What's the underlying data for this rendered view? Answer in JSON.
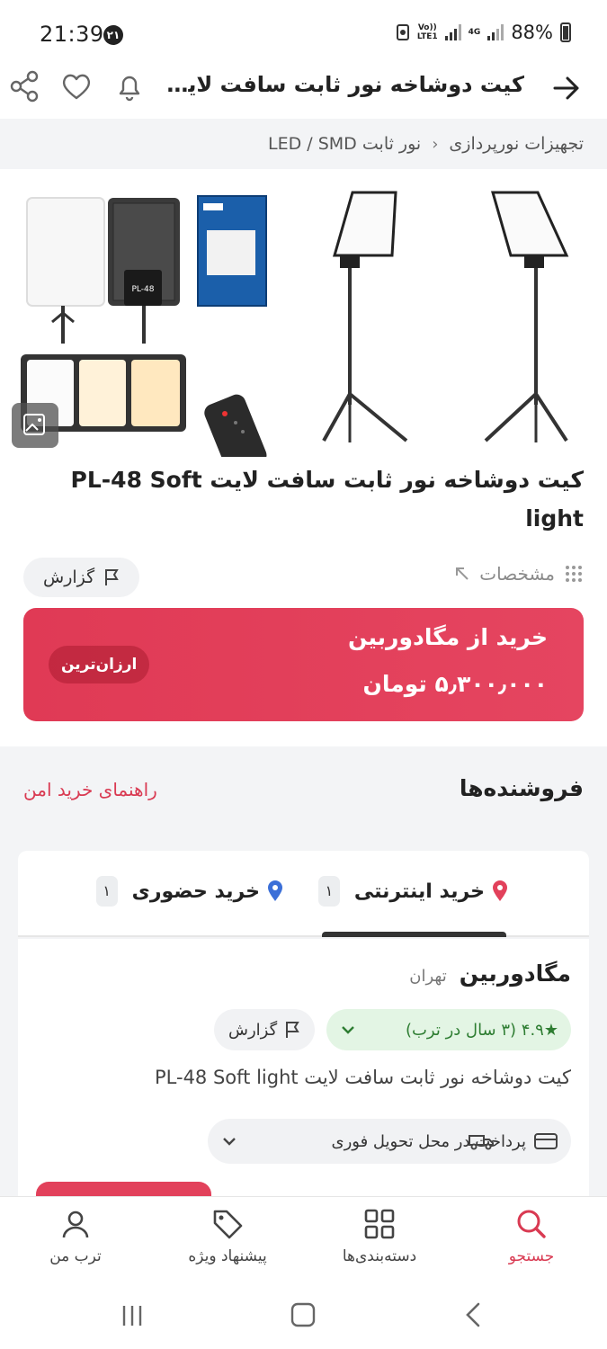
{
  "status_bar": {
    "time": "21:39",
    "notif_badge": "۲۱",
    "volte": "Vo))",
    "lte": "LTE1",
    "net": "4G",
    "battery": "88%"
  },
  "header": {
    "title": "کیت دوشاخه نور ثابت سافت لایت -..."
  },
  "breadcrumb": {
    "items": [
      "تجهیزات نورپردازی",
      "نور ثابت LED / SMD"
    ]
  },
  "product": {
    "title": "کیت دوشاخه نور ثابت سافت لایت PL-48 Soft light",
    "specs_label": "مشخصات",
    "report_label": "گزارش",
    "image_label_text": "PL-48"
  },
  "buy_card": {
    "store": "خرید از مگادوربین",
    "price": "۵٫۳۰۰٫۰۰۰ تومان",
    "tag": "ارزان‌ترین"
  },
  "sellers": {
    "heading": "فروشنده‌ها",
    "safe_guide": "راهنمای خرید امن",
    "tabs": [
      {
        "label": "خرید اینترنتی",
        "count": "۱"
      },
      {
        "label": "خرید حضوری",
        "count": "۱"
      }
    ],
    "seller": {
      "name": "مگادوربین",
      "city": "تهران",
      "rating": "★۴.۹ (۳ سال در ترب)",
      "report": "گزارش",
      "product": "کیت دوشاخه نور ثابت سافت لایت PL-48 Soft light",
      "features": "پرداخت در محل  تحویل فوری"
    }
  },
  "bottom_nav": {
    "search": "جستجو",
    "categories": "دسته‌بندی‌ها",
    "offers": "پیشنهاد ویژه",
    "profile": "ترب من"
  },
  "colors": {
    "brand": "#e2415b",
    "rating_bg": "#e3f5e4",
    "rating_fg": "#2e7d32"
  }
}
